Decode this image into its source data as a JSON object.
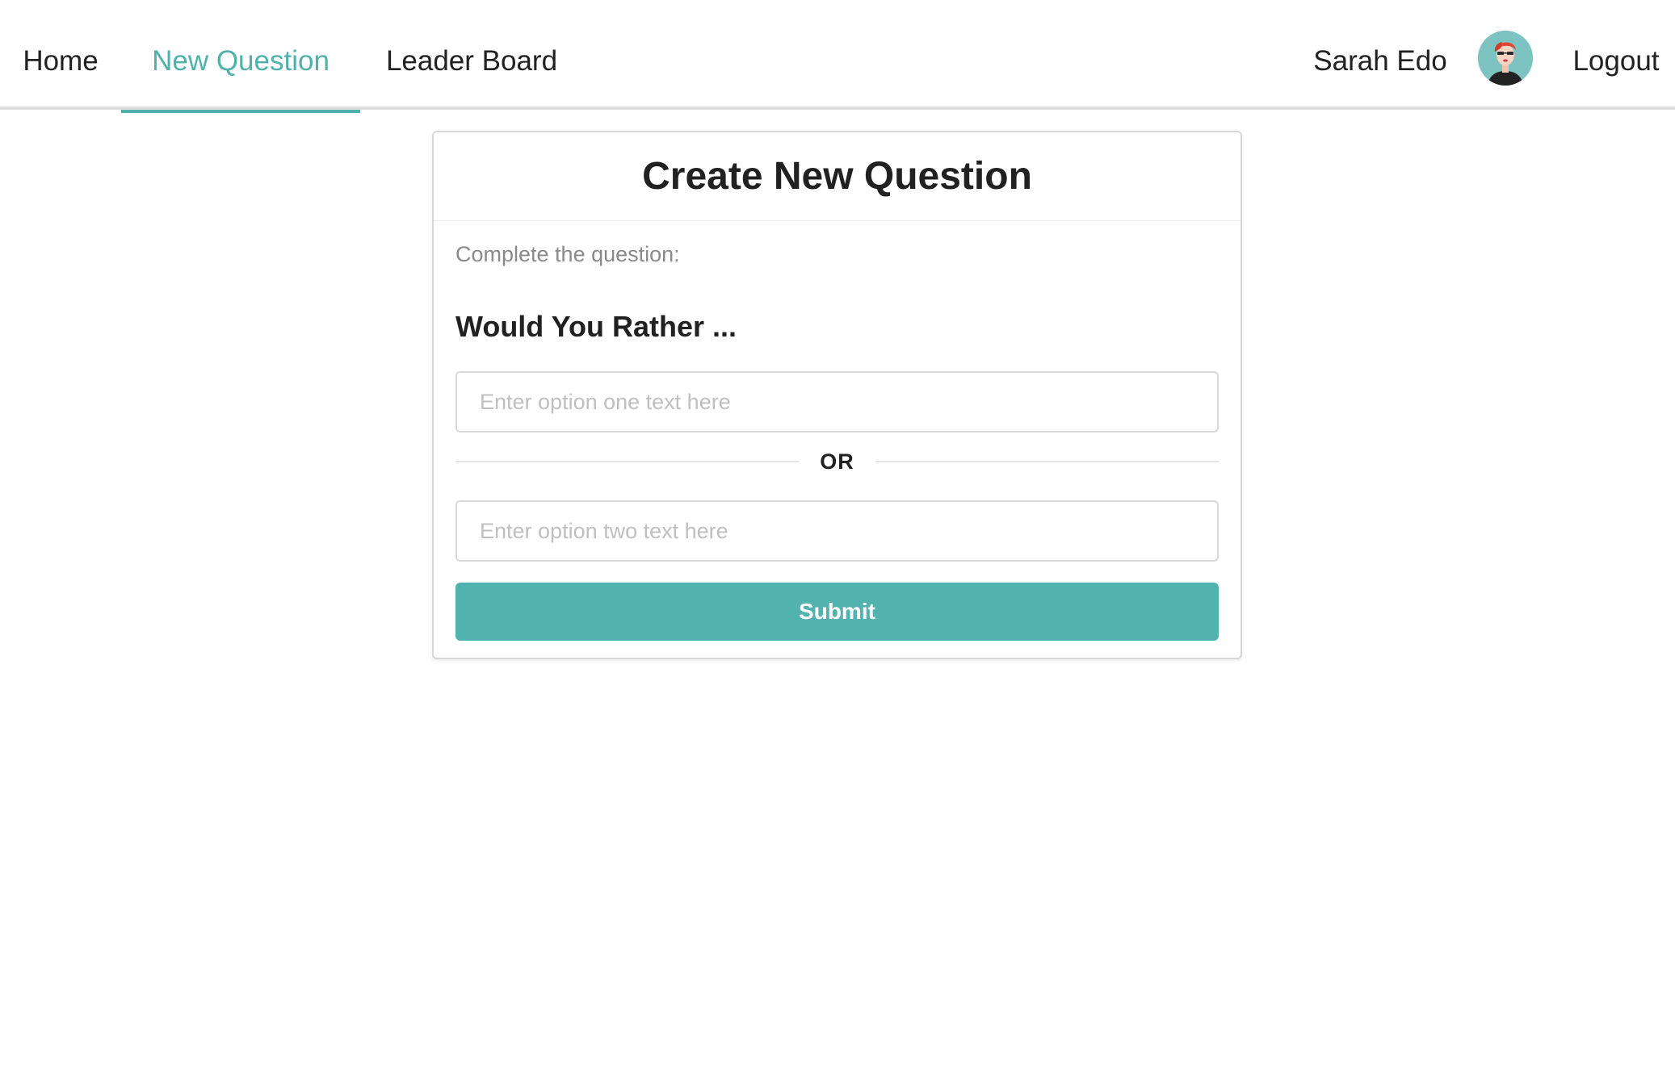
{
  "nav": {
    "home_label": "Home",
    "new_question_label": "New Question",
    "leader_board_label": "Leader Board",
    "user_name": "Sarah Edo",
    "logout_label": "Logout",
    "active_tab": "New Question",
    "accent_color": "#4fb1ab"
  },
  "card": {
    "title": "Create New Question",
    "instruction": "Complete the question:",
    "prompt": "Would You Rather ...",
    "option_one_placeholder": "Enter option one text here",
    "option_one_value": "",
    "divider_label": "OR",
    "option_two_placeholder": "Enter option two text here",
    "option_two_value": "",
    "submit_label": "Submit",
    "submit_color": "#51b2ae"
  }
}
